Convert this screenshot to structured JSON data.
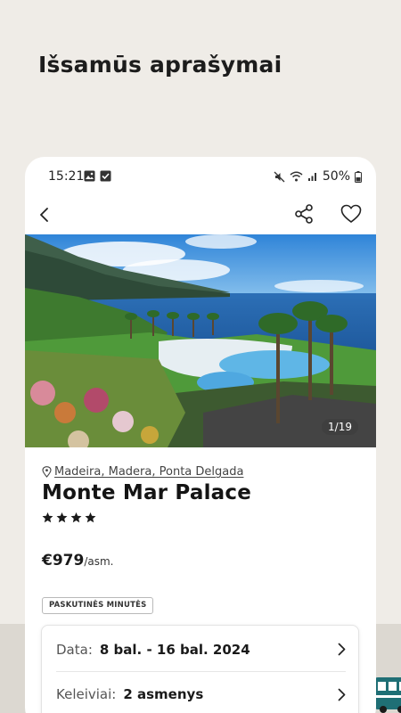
{
  "headline": "Išsamūs aprašymai",
  "status_bar": {
    "time": "15:21",
    "battery": "50%",
    "icons": [
      "gallery-icon",
      "check-square-icon",
      "mute-icon",
      "wifi-icon",
      "signal-icon",
      "battery-icon"
    ]
  },
  "nav": {
    "back_icon": "chevron-left-icon",
    "share_icon": "share-icon",
    "favorite_icon": "heart-icon"
  },
  "gallery": {
    "counter": "1/19"
  },
  "hotel": {
    "location": "Madeira, Madera, Ponta Delgada",
    "name": "Monte Mar Palace",
    "stars": 4,
    "price": "€979",
    "price_unit": "/asm.",
    "badge": "PASKUTINĖS MINUTĖS"
  },
  "booking": {
    "date_label": "Data:",
    "date_value": "8 bal. - 16 bal. 2024",
    "guests_label": "Keleiviai:",
    "guests_value": "2 asmenys"
  },
  "colors": {
    "background": "#efece7",
    "bottom_band": "#dcd8d1",
    "accent_teal": "#1f6f75"
  }
}
